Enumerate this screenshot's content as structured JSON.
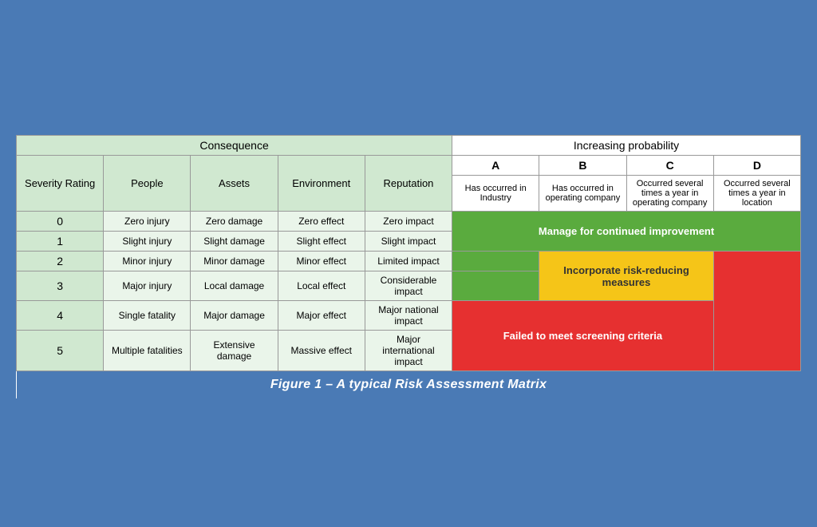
{
  "caption": "Figure 1 – A typical Risk Assessment Matrix",
  "headers": {
    "consequence": "Consequence",
    "increasing_probability": "Increasing probability"
  },
  "col_headers": {
    "severity_rating": "Severity Rating",
    "people": "People",
    "assets": "Assets",
    "environment": "Environment",
    "reputation": "Reputation",
    "prob_a": "A",
    "prob_b": "B",
    "prob_c": "C",
    "prob_d": "D",
    "prob_a_desc": "Has occurred in Industry",
    "prob_b_desc": "Has occurred in operating company",
    "prob_c_desc": "Occurred several times a year in operating company",
    "prob_d_desc": "Occurred several times a year in location"
  },
  "rows": [
    {
      "severity": "0",
      "people": "Zero injury",
      "assets": "Zero damage",
      "environment": "Zero effect",
      "reputation": "Zero impact"
    },
    {
      "severity": "1",
      "people": "Slight injury",
      "assets": "Slight damage",
      "environment": "Slight effect",
      "reputation": "Slight impact"
    },
    {
      "severity": "2",
      "people": "Minor injury",
      "assets": "Minor damage",
      "environment": "Minor effect",
      "reputation": "Limited impact"
    },
    {
      "severity": "3",
      "people": "Major injury",
      "assets": "Local damage",
      "environment": "Local effect",
      "reputation": "Considerable impact"
    },
    {
      "severity": "4",
      "people": "Single fatality",
      "assets": "Major damage",
      "environment": "Major effect",
      "reputation": "Major national impact"
    },
    {
      "severity": "5",
      "people": "Multiple fatalities",
      "assets": "Extensive damage",
      "environment": "Massive effect",
      "reputation": "Major international impact"
    }
  ],
  "zones": {
    "green_label": "Manage for continued improvement",
    "yellow_label": "Incorporate risk-reducing measures",
    "red_label": "Failed to meet screening criteria"
  }
}
